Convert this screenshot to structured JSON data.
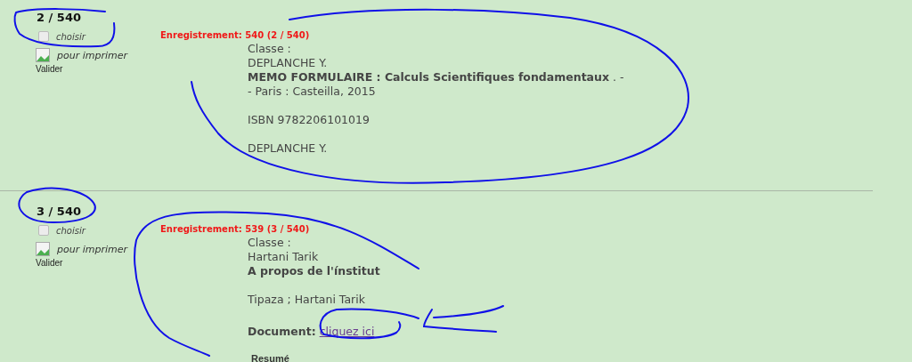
{
  "records": [
    {
      "counter": "2 / 540",
      "select": {
        "label": "choisir",
        "checked": false
      },
      "print_label": "pour imprimer",
      "image_alt": "Valider",
      "heading": "Enregistrement: 540 (2 / 540)",
      "lines": [
        {
          "kind": "text",
          "text": "Classe :"
        },
        {
          "kind": "text",
          "text": "DEPLANCHE Y."
        },
        {
          "kind": "text",
          "text": "**MEMO FORMULAIRE : Calculs Scientifiques fondamentaux** . -"
        },
        {
          "kind": "text",
          "text": "- Paris : Casteilla, 2015"
        },
        {
          "kind": "gap"
        },
        {
          "kind": "text",
          "text": "ISBN 9782206101019"
        },
        {
          "kind": "gap"
        },
        {
          "kind": "text",
          "text": "DEPLANCHE Y."
        }
      ]
    },
    {
      "counter": "3 / 540",
      "select": {
        "label": "choisir",
        "checked": false
      },
      "print_label": "pour imprimer",
      "image_alt": "Valider",
      "heading": "Enregistrement: 539 (3 / 540)",
      "lines": [
        {
          "kind": "text",
          "text": "Classe :"
        },
        {
          "kind": "text",
          "text": "Hartani Tarik"
        },
        {
          "kind": "title",
          "text": "A propos de l'ínstitut"
        },
        {
          "kind": "gap"
        },
        {
          "kind": "text",
          "text": "Tipaza ; Hartani Tarik"
        },
        {
          "kind": "gap"
        },
        {
          "kind": "link",
          "label": "Document:",
          "link": "cliquez ici"
        },
        {
          "kind": "section",
          "text": "Resumé"
        }
      ]
    }
  ]
}
